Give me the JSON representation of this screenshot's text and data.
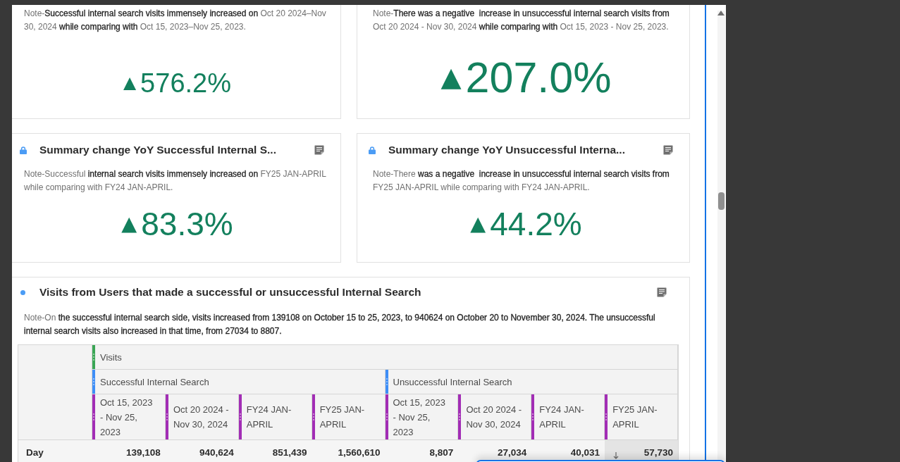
{
  "summary_cards": [
    {
      "note": "Note-**Successful internal search visits immensely increased on** Oct 20 2024–Nov 30, 2024 **while comparing with** Oct 15, 2023–Nov 25, 2023.",
      "arrow": "▲",
      "value": "576.2%"
    },
    {
      "note": "Note-**There was a negative  increase in unsuccessful internal search visits from** Oct 20 2024 - Nov 30, 2024 **while comparing with** Oct 15, 2023 - Nov 25, 2023.",
      "arrow": "▲",
      "value": "207.0%"
    },
    {
      "locked": true,
      "title": "Summary change YoY Successful Internal S...",
      "note": "Note-Successful **internal search visits immensely increased on** FY25 JAN-APRIL while comparing with FY24 JAN-APRIL.",
      "arrow": "▲",
      "value": "83.3%"
    },
    {
      "locked": true,
      "title": "Summary change YoY Unsuccessful Interna...",
      "note": "Note-There **was a negative  increase in unsuccessful internal search visits from** FY25 JAN-APRIL while comparing with FY24 JAN-APRIL.",
      "arrow": "▲",
      "value": "44.2%"
    }
  ],
  "table_card": {
    "locked": false,
    "title": "Visits from Users that made a successful or unsuccessful Internal Search",
    "note": "Note-On **the successful internal search side, visits increased from 139108 on October 15 to 25, 2023, to 940624 on October 20 to November 30, 2024. The unsuccessful internal search visits also increased in that time, from 27034 to 8807.**",
    "table": {
      "metric": "Visits",
      "segments": [
        "Successful Internal Search",
        "Unsuccessful Internal Search"
      ],
      "date_ranges": [
        "Oct 15, 2023 - Nov 25, 2023",
        "Oct 20 2024 - Nov 30, 2024",
        "FY24 JAN-APRIL",
        "FY25 JAN-APRIL",
        "Oct 15, 2023 - Nov 25, 2023",
        "Oct 20 2024 - Nov 30, 2024",
        "FY24 JAN-APRIL",
        "FY25 JAN-APRIL"
      ],
      "rows": [
        {
          "label": "Day",
          "cells": [
            {
              "value": "139,108",
              "sorted": false
            },
            {
              "value": "940,624",
              "sorted": false
            },
            {
              "value": "851,439",
              "sorted": false
            },
            {
              "value": "1,560,610",
              "sorted": false
            },
            {
              "value": "8,807",
              "sorted": false
            },
            {
              "value": "27,034",
              "sorted": false
            },
            {
              "value": "40,031",
              "sorted": false
            },
            {
              "value": "57,730",
              "sorted": true
            }
          ]
        }
      ]
    }
  }
}
